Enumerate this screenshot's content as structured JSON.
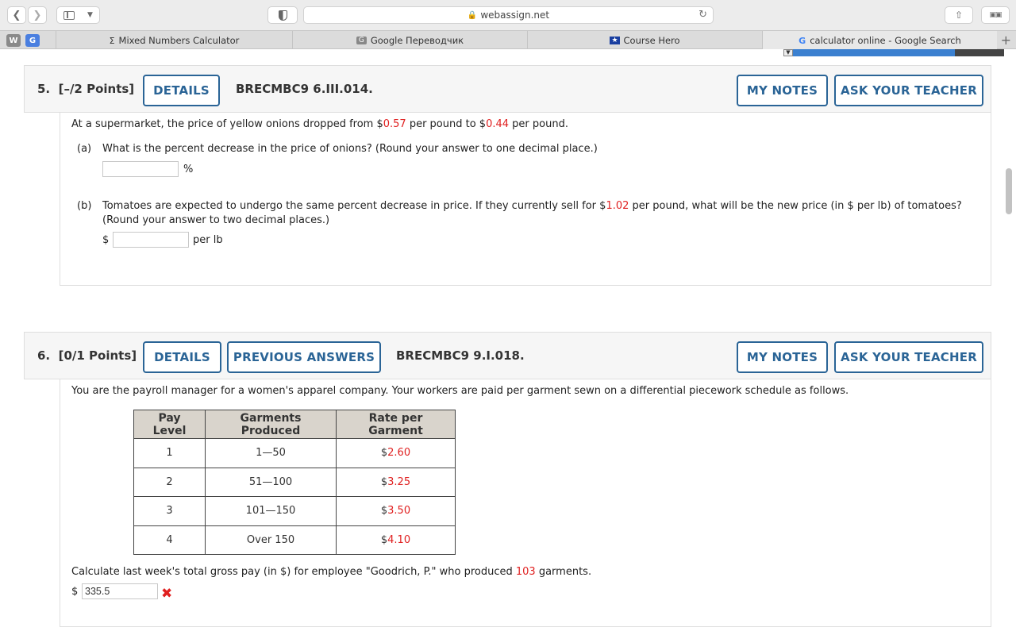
{
  "browser": {
    "url": "webassign.net",
    "tabs": [
      {
        "icon": "Σ",
        "label": "Mixed Numbers Calculator"
      },
      {
        "icon": "G",
        "label": "Google Переводчик"
      },
      {
        "icon": "★",
        "label": "Course Hero"
      },
      {
        "icon": "G",
        "label": "calculator online - Google Search"
      }
    ]
  },
  "q5": {
    "number": "5.",
    "points": "[–/2 Points]",
    "details_label": "DETAILS",
    "code": "BRECMBC9 6.III.014.",
    "my_notes_label": "MY NOTES",
    "ask_label": "ASK YOUR TEACHER",
    "intro_1": "At a supermarket, the price of yellow onions dropped from $",
    "price_old": "0.57",
    "intro_2": " per pound to $",
    "price_new": "0.44",
    "intro_3": " per pound.",
    "a_label": "(a)",
    "a_text": "What is the percent decrease in the price of onions? (Round your answer to one decimal place.)",
    "a_unit": "%",
    "a_value": "",
    "b_label": "(b)",
    "b_text_1": "Tomatoes are expected to undergo the same percent decrease in price. If they currently sell for $",
    "b_price": "1.02",
    "b_text_2": " per pound, what will be the new price (in $ per lb) of tomatoes?",
    "b_text_3": "(Round your answer to two decimal places.)",
    "b_prefix": "$",
    "b_unit": "per lb",
    "b_value": ""
  },
  "q6": {
    "number": "6.",
    "points": "[0/1 Points]",
    "details_label": "DETAILS",
    "prev_label": "PREVIOUS ANSWERS",
    "code": "BRECMBC9 9.I.018.",
    "my_notes_label": "MY NOTES",
    "ask_label": "ASK YOUR TEACHER",
    "intro": "You are the payroll manager for a women's apparel company. Your workers are paid per garment sewn on a differential piecework schedule as follows.",
    "table": {
      "headers": [
        "Pay Level",
        "Garments Produced",
        "Rate per Garment"
      ],
      "rows": [
        {
          "level": "1",
          "produced": "1—50",
          "rate": "2.60"
        },
        {
          "level": "2",
          "produced": "51—100",
          "rate": "3.25"
        },
        {
          "level": "3",
          "produced": "101—150",
          "rate": "3.50"
        },
        {
          "level": "4",
          "produced": "Over 150",
          "rate": "4.10"
        }
      ]
    },
    "calc_1": "Calculate last week's total gross pay (in $) for employee \"Goodrich, P.\" who produced ",
    "garments": "103",
    "calc_2": " garments.",
    "prefix": "$",
    "answer": "335.5",
    "status_icon": "cross-icon"
  }
}
